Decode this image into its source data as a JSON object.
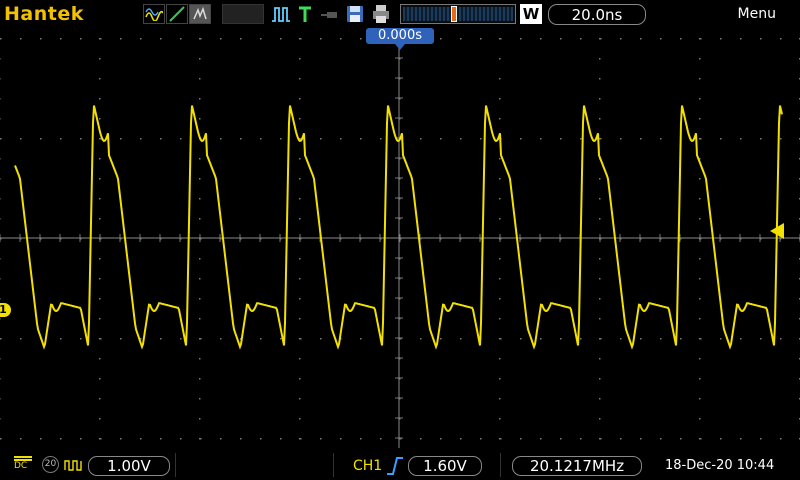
{
  "topbar": {
    "brand": "Hantek",
    "mode_icons": [
      "waveform-mode-icon",
      "ramp-mode-icon",
      "persist-mode-icon"
    ],
    "run_state_icon": "run-stop-icon",
    "trigger_type_icon": "trigger-T-icon",
    "save_icon": "save-icon",
    "print_icon": "print-icon",
    "window_label": "W",
    "timebase": "20.0ns",
    "menu_label": "Menu"
  },
  "screen": {
    "trigger_position": "0.000s",
    "channel_marker": "1"
  },
  "bottombar": {
    "coupling_label": "DC",
    "bw_limit_label": "20",
    "ch1_scale": "1.00V",
    "trigger_source": "CH1",
    "trigger_level": "1.60V",
    "frequency": "20.1217MHz",
    "datetime": "18-Dec-20 10:44"
  },
  "colors": {
    "brand": "#f2c200",
    "trace": "#f2e000",
    "trigger_marker": "#2f62ba",
    "graticule": "#7a7a7a"
  }
}
